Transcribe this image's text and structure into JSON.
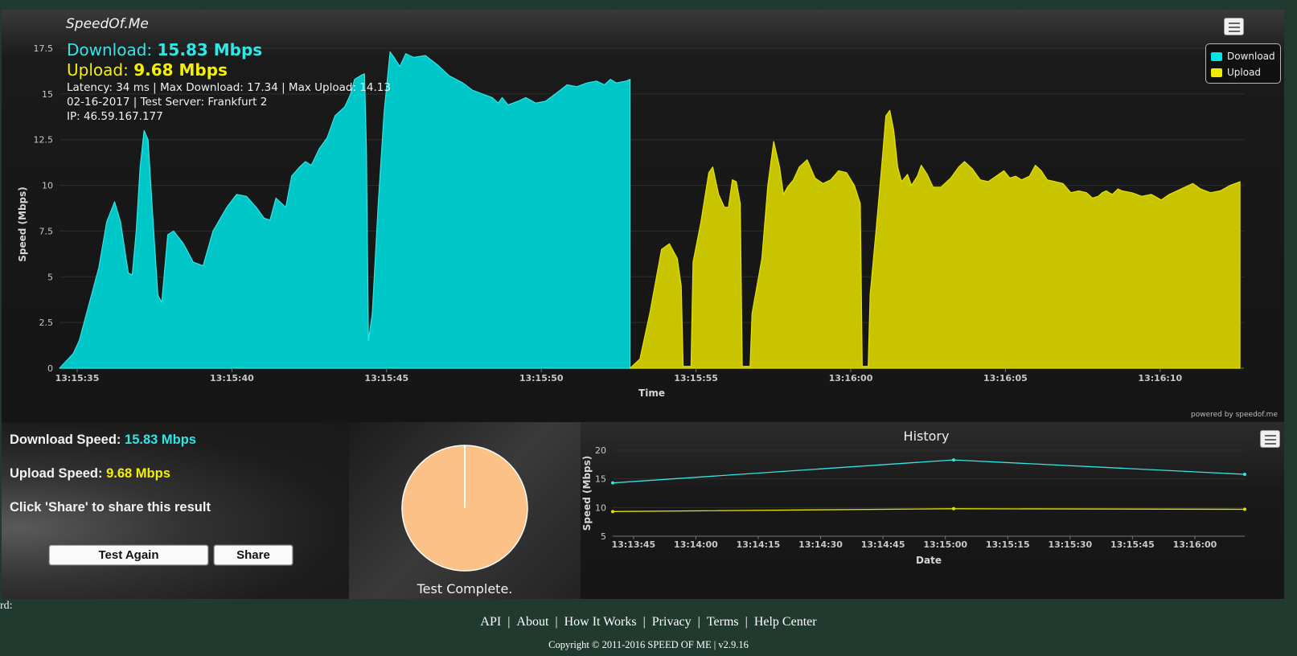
{
  "brand": "SpeedOf.Me",
  "summary": {
    "download_label": "Download:",
    "download_value": "15.83 Mbps",
    "upload_label": "Upload:",
    "upload_value": "9.68 Mbps",
    "line1": "Latency: 34 ms | Max Download: 17.34 | Max Upload: 14.13",
    "line2": "02-16-2017 | Test Server: Frankfurt 2",
    "line3": "IP: 46.59.167.177"
  },
  "legend": {
    "download": "Download",
    "upload": "Upload"
  },
  "powered_by": "powered by speedof.me",
  "colors": {
    "download": "#00c7c7",
    "download_line": "#33e5e5",
    "upload": "#c9c400",
    "upload_line": "#e6e200",
    "pie": "#fcc187"
  },
  "results": {
    "download_label": "Download Speed:",
    "download_value": "15.83 Mbps",
    "upload_label": "Upload Speed:",
    "upload_value": "9.68 Mbps",
    "share_hint": "Click 'Share' to share this result",
    "test_again_label": "Test Again",
    "share_label": "Share"
  },
  "progress": {
    "status": "Test Complete.",
    "fraction": 1.0
  },
  "history_title": "History",
  "side_cut_text": "rd:",
  "footer": {
    "links": [
      "API",
      "About",
      "How It Works",
      "Privacy",
      "Terms",
      "Help Center"
    ],
    "copyright": "Copyright © 2011-2016 SPEED OF ME | v2.9.16"
  },
  "chart_data": [
    {
      "type": "area",
      "title": "",
      "xlabel": "Time",
      "ylabel": "Speed (Mbps)",
      "ylim": [
        0,
        17.5
      ],
      "yticks": [
        0,
        2.5,
        5,
        7.5,
        10,
        12.5,
        15,
        17.5
      ],
      "xlim_seconds": [
        0,
        39.5
      ],
      "xticks": [
        {
          "t": 0,
          "label": "13:15:35"
        },
        {
          "t": 5,
          "label": "13:15:40"
        },
        {
          "t": 10,
          "label": "13:15:45"
        },
        {
          "t": 15,
          "label": "13:15:50"
        },
        {
          "t": 20,
          "label": "13:15:55"
        },
        {
          "t": 25,
          "label": "13:16:00"
        },
        {
          "t": 30,
          "label": "13:16:05"
        },
        {
          "t": 35,
          "label": "13:16:10"
        }
      ],
      "grid": true,
      "legend": "top-right",
      "series": [
        {
          "name": "Download",
          "points": [
            [
              0,
              0
            ],
            [
              0.7,
              0.8
            ],
            [
              1.0,
              1.5
            ],
            [
              1.5,
              3.5
            ],
            [
              2.0,
              5.5
            ],
            [
              2.4,
              8.0
            ],
            [
              2.8,
              9.1
            ],
            [
              3.1,
              8.0
            ],
            [
              3.5,
              5.2
            ],
            [
              3.7,
              5.1
            ],
            [
              3.9,
              7.5
            ],
            [
              4.1,
              11.0
            ],
            [
              4.3,
              13.0
            ],
            [
              4.5,
              12.5
            ],
            [
              4.7,
              9.0
            ],
            [
              5.0,
              4.0
            ],
            [
              5.2,
              3.6
            ],
            [
              5.5,
              7.3
            ],
            [
              5.8,
              7.5
            ],
            [
              6.3,
              6.8
            ],
            [
              6.8,
              5.8
            ],
            [
              7.3,
              5.6
            ],
            [
              7.8,
              7.5
            ],
            [
              8.5,
              8.8
            ],
            [
              9.0,
              9.5
            ],
            [
              9.5,
              9.4
            ],
            [
              10.0,
              8.8
            ],
            [
              10.4,
              8.2
            ],
            [
              10.7,
              8.1
            ],
            [
              11.0,
              9.3
            ],
            [
              11.3,
              9.0
            ],
            [
              11.5,
              8.8
            ],
            [
              11.8,
              10.5
            ],
            [
              12.2,
              11.0
            ],
            [
              12.5,
              11.3
            ],
            [
              12.8,
              11.1
            ],
            [
              13.2,
              12.0
            ],
            [
              13.6,
              12.6
            ],
            [
              14.0,
              13.8
            ],
            [
              14.5,
              14.3
            ],
            [
              14.8,
              15.0
            ],
            [
              15.0,
              15.8
            ],
            [
              15.3,
              16.0
            ],
            [
              15.5,
              16.1
            ],
            [
              15.6,
              12.0
            ],
            [
              15.7,
              1.5
            ],
            [
              15.9,
              3.0
            ],
            [
              16.2,
              9.0
            ],
            [
              16.5,
              14.0
            ],
            [
              16.8,
              17.3
            ],
            [
              17.0,
              17.0
            ],
            [
              17.3,
              16.5
            ],
            [
              17.6,
              17.2
            ],
            [
              18.0,
              17.0
            ],
            [
              18.6,
              17.1
            ],
            [
              19.2,
              16.6
            ],
            [
              19.8,
              16.0
            ],
            [
              20.5,
              15.6
            ],
            [
              21.0,
              15.2
            ],
            [
              21.5,
              15.0
            ],
            [
              22.0,
              14.8
            ],
            [
              22.3,
              14.5
            ],
            [
              22.5,
              14.8
            ],
            [
              22.8,
              14.4
            ],
            [
              23.3,
              14.6
            ],
            [
              23.7,
              14.8
            ],
            [
              24.2,
              14.5
            ],
            [
              24.7,
              14.6
            ],
            [
              25.2,
              15.0
            ],
            [
              25.8,
              15.5
            ],
            [
              26.3,
              15.4
            ],
            [
              26.8,
              15.6
            ],
            [
              27.3,
              15.7
            ],
            [
              27.7,
              15.5
            ],
            [
              28.0,
              15.8
            ],
            [
              28.3,
              15.6
            ],
            [
              28.8,
              15.7
            ],
            [
              29.0,
              15.8
            ]
          ]
        },
        {
          "name": "Upload",
          "points": [
            [
              29.0,
              0
            ],
            [
              29.5,
              0.5
            ],
            [
              30.0,
              3.0
            ],
            [
              30.6,
              6.5
            ],
            [
              31.0,
              6.8
            ],
            [
              31.4,
              6.0
            ],
            [
              31.6,
              4.5
            ],
            [
              31.7,
              0.1
            ],
            [
              32.1,
              0.1
            ],
            [
              32.2,
              5.8
            ],
            [
              32.6,
              8.0
            ],
            [
              33.0,
              10.7
            ],
            [
              33.2,
              11.0
            ],
            [
              33.5,
              9.5
            ],
            [
              33.8,
              8.8
            ],
            [
              34.0,
              8.8
            ],
            [
              34.2,
              10.3
            ],
            [
              34.4,
              10.2
            ],
            [
              34.6,
              9.0
            ],
            [
              34.7,
              0.1
            ],
            [
              35.1,
              0.1
            ],
            [
              35.2,
              3.0
            ],
            [
              35.7,
              6.0
            ],
            [
              36.0,
              10.0
            ],
            [
              36.3,
              12.4
            ],
            [
              36.6,
              11.0
            ],
            [
              36.8,
              9.5
            ],
            [
              37.0,
              9.9
            ],
            [
              37.3,
              10.3
            ],
            [
              37.6,
              11.0
            ],
            [
              38.0,
              11.4
            ],
            [
              38.4,
              10.4
            ],
            [
              38.8,
              10.1
            ],
            [
              39.2,
              10.3
            ],
            [
              39.6,
              10.8
            ],
            [
              40.0,
              10.7
            ],
            [
              40.4,
              10.0
            ],
            [
              40.7,
              9.0
            ],
            [
              40.8,
              0.1
            ],
            [
              41.1,
              0.1
            ],
            [
              41.2,
              4.0
            ],
            [
              41.5,
              7.5
            ],
            [
              41.8,
              11.2
            ],
            [
              42.0,
              13.8
            ],
            [
              42.2,
              14.1
            ],
            [
              42.4,
              13.0
            ],
            [
              42.6,
              11.0
            ],
            [
              42.8,
              10.2
            ],
            [
              43.1,
              10.6
            ],
            [
              43.3,
              10.0
            ],
            [
              43.6,
              10.5
            ],
            [
              43.8,
              11.1
            ],
            [
              44.1,
              10.6
            ],
            [
              44.4,
              9.9
            ],
            [
              44.8,
              9.9
            ],
            [
              45.3,
              10.4
            ],
            [
              45.7,
              11.0
            ],
            [
              46.0,
              11.3
            ],
            [
              46.4,
              10.9
            ],
            [
              46.8,
              10.3
            ],
            [
              47.2,
              10.2
            ],
            [
              47.6,
              10.5
            ],
            [
              48.0,
              10.8
            ],
            [
              48.3,
              10.4
            ],
            [
              48.6,
              10.5
            ],
            [
              48.9,
              10.3
            ],
            [
              49.3,
              10.5
            ],
            [
              49.6,
              11.1
            ],
            [
              49.9,
              10.8
            ],
            [
              50.2,
              10.3
            ],
            [
              50.6,
              10.2
            ],
            [
              51.0,
              10.1
            ],
            [
              51.4,
              9.6
            ],
            [
              51.8,
              9.7
            ],
            [
              52.2,
              9.6
            ],
            [
              52.5,
              9.3
            ],
            [
              52.8,
              9.4
            ],
            [
              53.0,
              9.6
            ],
            [
              53.2,
              9.7
            ],
            [
              53.5,
              9.5
            ],
            [
              53.8,
              9.8
            ],
            [
              54.0,
              9.7
            ],
            [
              54.5,
              9.6
            ],
            [
              55.0,
              9.4
            ],
            [
              55.5,
              9.5
            ],
            [
              56.0,
              9.2
            ],
            [
              56.4,
              9.5
            ],
            [
              56.8,
              9.7
            ],
            [
              57.2,
              9.9
            ],
            [
              57.6,
              10.1
            ],
            [
              58.0,
              9.8
            ],
            [
              58.5,
              9.6
            ],
            [
              59.0,
              9.7
            ],
            [
              59.5,
              10.0
            ],
            [
              60.0,
              10.2
            ]
          ]
        }
      ]
    },
    {
      "type": "line",
      "title": "History",
      "xlabel": "Date",
      "ylabel": "Speed (Mbps)",
      "ylim": [
        5,
        20
      ],
      "yticks": [
        5,
        10,
        15,
        20
      ],
      "x_labels": [
        "13:13:45",
        "13:14:00",
        "13:14:15",
        "13:14:30",
        "13:14:45",
        "13:15:00",
        "13:15:15",
        "13:15:30",
        "13:15:45",
        "13:16:00"
      ],
      "series": [
        {
          "name": "Download",
          "x": [
            "13:13:40",
            "13:15:02",
            "13:16:12"
          ],
          "values": [
            14.3,
            18.3,
            15.8
          ]
        },
        {
          "name": "Upload",
          "x": [
            "13:13:40",
            "13:15:02",
            "13:16:12"
          ],
          "values": [
            9.3,
            9.8,
            9.7
          ]
        }
      ]
    }
  ]
}
